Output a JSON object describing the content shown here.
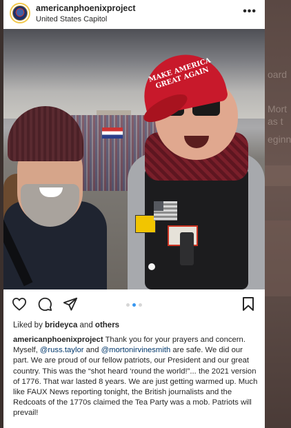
{
  "post": {
    "username": "americanphoenixproject",
    "location": "United States Capitol",
    "more_icon": "•••",
    "photo": {
      "cap_line1": "MAKE AMERICA",
      "cap_line2": "GREAT AGAIN"
    },
    "carousel": {
      "count": 3,
      "active": 2
    },
    "likes": {
      "prefix": "Liked by ",
      "user": "brideyca",
      "middle": " and ",
      "others": "others"
    },
    "caption": {
      "user": "americanphoenixproject",
      "text1": " Thank you for your prayers and concern. Myself, ",
      "mention1": "@russ.taylor",
      "text2": " and ",
      "mention2": "@mortonirvinesmith",
      "text3": " are safe. We did our part. We are proud of our fellow patriots, our President and our great country. This was the “shot heard ‘round the world!”... the 2021 version of 1776. That war lasted 8 years. We are just getting warmed up. Much like FAUX News reporting tonight, the British journalists and the Redcoats of the 1770s claimed the Tea Party was a mob. Patriots will prevail!"
    }
  },
  "background_fragments": {
    "line1": "oard",
    "line2": "Mort",
    "line3": "as t",
    "line4": "eginn"
  },
  "icons": [
    "heart-icon",
    "comment-icon",
    "share-icon",
    "bookmark-icon",
    "more-icon"
  ],
  "colors": {
    "accent": "#3897f0",
    "mention": "#00376b",
    "avatar_ring": "#f2c94c",
    "cap_red": "#c8192b"
  }
}
